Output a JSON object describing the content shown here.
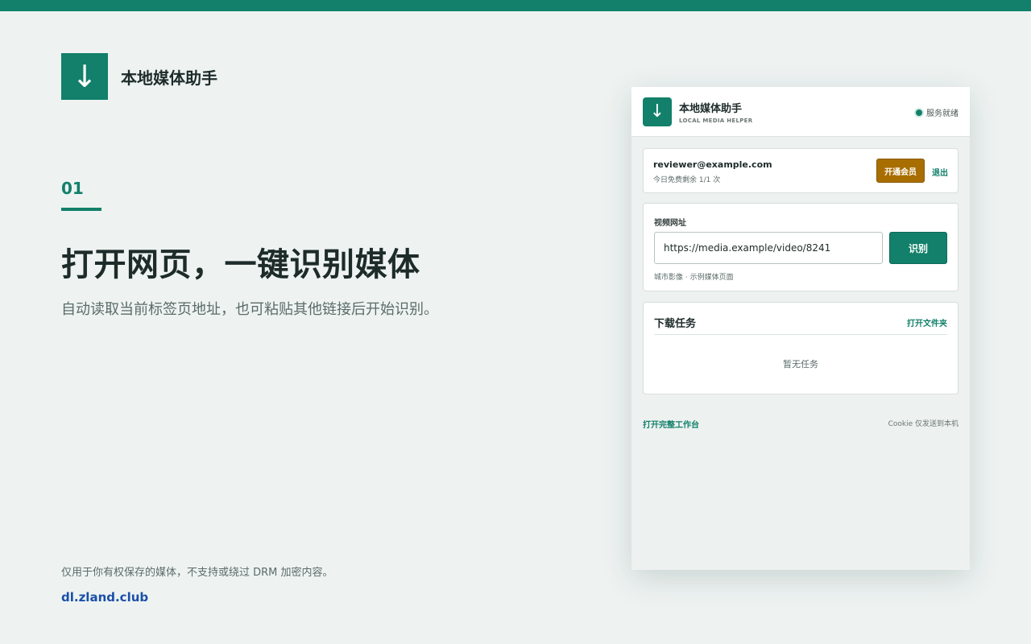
{
  "brand": {
    "logo_glyph": "↓",
    "name": "本地媒体助手"
  },
  "hero": {
    "step": "01",
    "headline": "打开网页，一键识别媒体",
    "subline": "自动读取当前标签页地址，也可粘贴其他链接后开始识别。"
  },
  "footer": {
    "disclaimer": "仅用于你有权保存的媒体，不支持或绕过 DRM 加密内容。",
    "link": "dl.zland.club"
  },
  "popup": {
    "header": {
      "logo_glyph": "↓",
      "title": "本地媒体助手",
      "subtitle": "LOCAL MEDIA HELPER",
      "status": "服务就绪"
    },
    "account": {
      "email": "reviewer@example.com",
      "quota": "今日免费剩余 1/1 次",
      "vip_label": "开通会员",
      "logout_label": "退出"
    },
    "url": {
      "label": "视频网址",
      "value": "https://media.example/video/8241",
      "button": "识别",
      "hint": "城市影像 · 示例媒体页面"
    },
    "tasks": {
      "title": "下载任务",
      "open_folder": "打开文件夹",
      "empty": "暂无任务"
    },
    "bottom": {
      "workbench": "打开完整工作台",
      "cookie_note": "Cookie 仅发送到本机"
    }
  },
  "colors": {
    "accent": "#12806a",
    "vip": "#a86e00",
    "link": "#1b4fa8",
    "background": "#eef3f2"
  }
}
